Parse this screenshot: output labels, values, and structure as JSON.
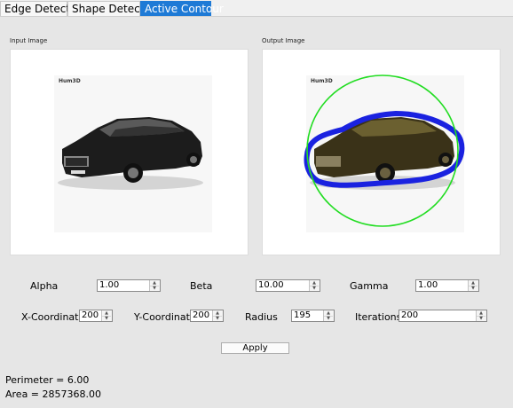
{
  "tabs": [
    {
      "label": "Edge Detector",
      "active": false
    },
    {
      "label": "Shape Detector",
      "active": false
    },
    {
      "label": "Active Contour",
      "active": true
    }
  ],
  "input_image": {
    "label": "Input Image",
    "watermark": "Hum3D"
  },
  "output_image": {
    "label": "Output Image",
    "watermark": "Hum3D"
  },
  "params": {
    "alpha": {
      "label": "Alpha",
      "value": "1.00"
    },
    "beta": {
      "label": "Beta",
      "value": "10.00"
    },
    "gamma": {
      "label": "Gamma",
      "value": "1.00"
    },
    "x_coordinate": {
      "label": "X-Coordinate",
      "value": "200"
    },
    "y_coordinate": {
      "label": "Y-Coordinate",
      "value": "200"
    },
    "radius": {
      "label": "Radius",
      "value": "195"
    },
    "iterations": {
      "label": "Iterations",
      "value": "200"
    }
  },
  "apply_label": "Apply",
  "results": {
    "perimeter": "Perimeter = 6.00",
    "area": "Area = 2857368.00"
  },
  "colors": {
    "accent": "#1e7ad6",
    "contour_initial": "#22dd22",
    "contour_final": "#1a22e0"
  }
}
